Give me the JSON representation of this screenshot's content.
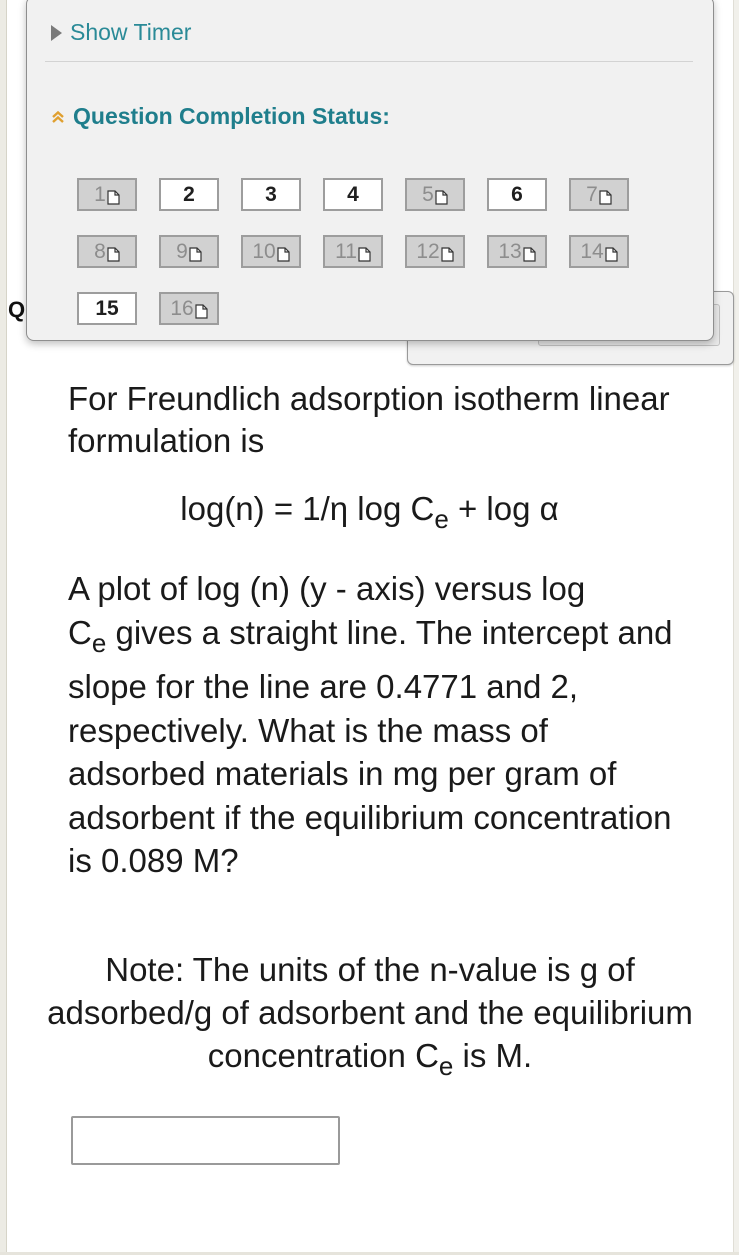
{
  "timer": {
    "toggle_label": "Show Timer",
    "icon": "triangle-right-icon"
  },
  "completion": {
    "title": "Question Completion Status:",
    "icon": "double-chevron-up-icon",
    "questions": [
      {
        "number": "1",
        "state": "answered"
      },
      {
        "number": "2",
        "state": "unanswered"
      },
      {
        "number": "3",
        "state": "unanswered"
      },
      {
        "number": "4",
        "state": "unanswered"
      },
      {
        "number": "5",
        "state": "answered"
      },
      {
        "number": "6",
        "state": "unanswered"
      },
      {
        "number": "7",
        "state": "answered"
      },
      {
        "number": "8",
        "state": "answered"
      },
      {
        "number": "9",
        "state": "answered"
      },
      {
        "number": "10",
        "state": "answered"
      },
      {
        "number": "11",
        "state": "answered"
      },
      {
        "number": "12",
        "state": "answered"
      },
      {
        "number": "13",
        "state": "answered"
      },
      {
        "number": "14",
        "state": "answered"
      },
      {
        "number": "15",
        "state": "unanswered"
      },
      {
        "number": "16",
        "state": "answered"
      }
    ],
    "answered_icon": "document-icon"
  },
  "background": {
    "partial_label": "Q"
  },
  "question": {
    "intro": "For Freundlich adsorption isotherm linear formulation is",
    "equation": {
      "part1": "log(n) = 1/η log C",
      "sub": "e",
      "part2": " + log α"
    },
    "body": {
      "line1": "A plot of log (n) (y - axis) versus log",
      "c": "C",
      "sub": "e",
      "rest": " gives a straight line. The intercept and slope for the line are 0.4771 and 2, respectively. What is the mass of adsorbed materials in mg per gram of adsorbent if the equilibrium concentration is 0.089 M?"
    },
    "note": {
      "part1": "Note: The units of the n-value is g of adsorbed/g of adsorbent and the equilibrium concentration C",
      "sub": "e",
      "part2": " is M."
    }
  },
  "answer": {
    "value": "",
    "placeholder": ""
  },
  "colors": {
    "link_teal": "#2a8a97",
    "status_teal": "#1f7e8c",
    "chevron_gold": "#e0a030",
    "answered_bg": "#d1d1d1",
    "unanswered_bg": "#ffffff"
  }
}
